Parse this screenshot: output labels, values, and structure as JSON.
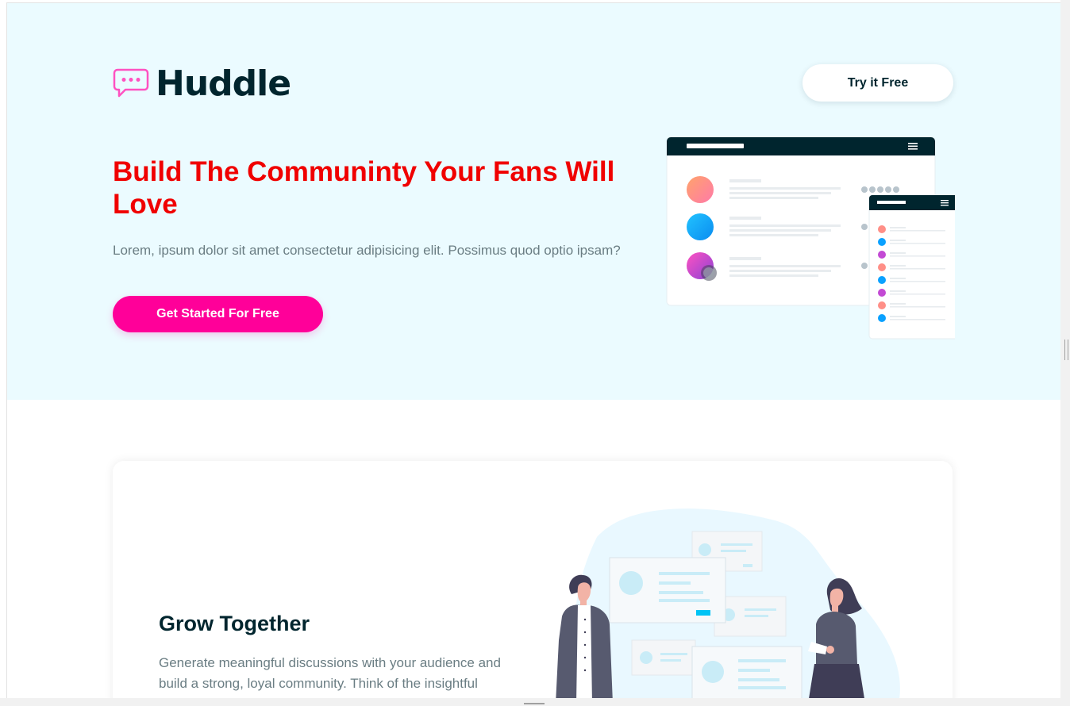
{
  "header": {
    "logo_text": "Huddle",
    "logo_icon": "chat-bubble-icon",
    "try_button_label": "Try it Free"
  },
  "hero": {
    "title": "Build The Communinty Your Fans Will Love",
    "description": "Lorem, ipsum dolor sit amet consectetur adipisicing elit. Possimus quod optio ipsam?",
    "cta_label": "Get Started For Free",
    "mockup": "app-mockup-illustration"
  },
  "features": [
    {
      "title": "Grow Together",
      "description": "Generate meaningful discussions with your audience and build a strong, loyal community. Think of the insightful",
      "illustration": "people-discussion-illustration"
    }
  ],
  "colors": {
    "hero_background": "#ebfbff",
    "brand_dark": "#00252e",
    "title_red": "#f00000",
    "accent_pink": "#ff0099",
    "body_gray": "#6a7d83"
  }
}
